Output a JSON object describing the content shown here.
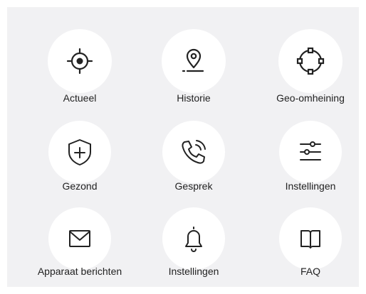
{
  "menu": {
    "items": [
      {
        "label": "Actueel",
        "icon": "crosshair-icon"
      },
      {
        "label": "Historie",
        "icon": "map-pin-icon"
      },
      {
        "label": "Geo-omheining",
        "icon": "geofence-circle-icon"
      },
      {
        "label": "Gezond",
        "icon": "shield-plus-icon"
      },
      {
        "label": "Gesprek",
        "icon": "phone-call-icon"
      },
      {
        "label": "Instellingen",
        "icon": "sliders-icon"
      },
      {
        "label": "Apparaat berichten",
        "icon": "envelope-icon"
      },
      {
        "label": "Instellingen",
        "icon": "bell-icon"
      },
      {
        "label": "FAQ",
        "icon": "book-icon"
      }
    ]
  },
  "colors": {
    "panel_background": "#f1f1f3",
    "circle_background": "#ffffff",
    "icon_stroke": "#222222",
    "label_text": "#222222"
  }
}
